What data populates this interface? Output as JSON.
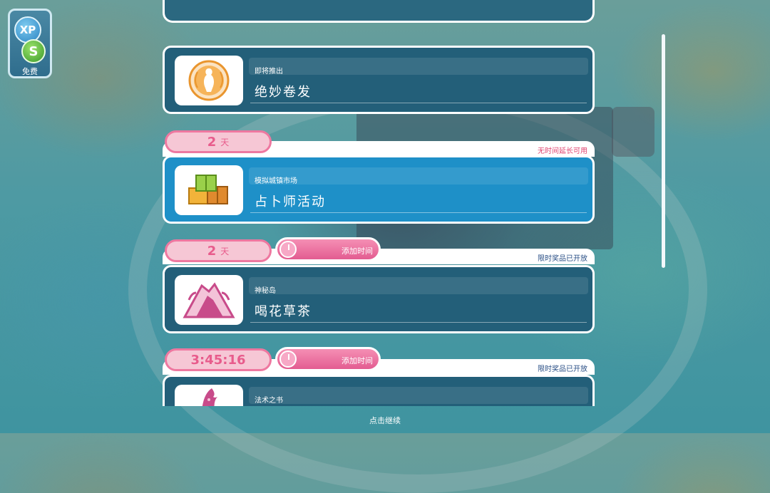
{
  "hud": {
    "xp_label": "XP",
    "simoleon_label": "S",
    "free_label": "免费"
  },
  "events": [
    {
      "subtitle": "即将推出",
      "title": "绝妙卷发",
      "icon": "golden-lady-laurel-icon"
    },
    {
      "timer": "2",
      "timer_unit": "天",
      "note": "无时间延长可用",
      "subtitle": "模拟城镇市场",
      "title": "占卜师活动",
      "icon": "crates-icon"
    },
    {
      "timer": "2",
      "timer_unit": "天",
      "add_time_label": "添加时间",
      "note": "限时奖品已开放",
      "subtitle": "神秘岛",
      "title": "喝花草茶",
      "icon": "volcano-island-icon"
    },
    {
      "timer": "3:45:16",
      "add_time_label": "添加时间",
      "note": "限时奖品已开放",
      "subtitle": "法术之书",
      "icon": "wizard-hat-icon"
    }
  ],
  "footer": {
    "hint": "点击继续"
  },
  "colors": {
    "card_dark": "#235f79",
    "card_active": "#1e90c8",
    "pink": "#e85c8c",
    "pill_bg": "#f6c7d5",
    "note_red": "#e0436f",
    "note_blue": "#2a4f86"
  }
}
